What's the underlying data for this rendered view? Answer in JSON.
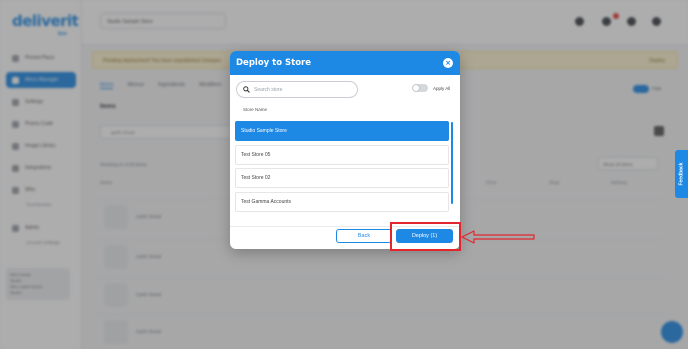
{
  "app": {
    "logo": "deliverit",
    "logo_sub": "bos",
    "store_selector": "Studio Sample Store",
    "sidebar": {
      "items": [
        {
          "label": "Pinned Place"
        },
        {
          "label": "Menu Manager"
        },
        {
          "label": "Settings"
        },
        {
          "label": "Promo Code"
        },
        {
          "label": "Image Library"
        },
        {
          "label": "Integrations"
        },
        {
          "label": "Who"
        },
        {
          "label": "Admin"
        }
      ],
      "sub_items": [
        "Touchscreen",
        "Account Settings"
      ],
      "user": {
        "line1": "Who Invoke",
        "line2": "Studio",
        "line3": "Who Latest Versio",
        "line4": "Studio"
      }
    },
    "banner": {
      "text": "Pending deployment! You have unpublished changes.",
      "action": "Deploy"
    },
    "tabs": [
      "Items",
      "Menus",
      "Ingredients",
      "Modifiers"
    ],
    "toggle_label": "Hide",
    "items_label": "Items",
    "search_placeholder": "garlic bread",
    "showing": "Showing 11 of 28 items",
    "per_page": "Show 20 items",
    "columns": [
      "Name",
      "Price",
      "Shop",
      "Delivery"
    ],
    "rows": [
      {
        "name": "Garlic Bread"
      },
      {
        "name": "Garlic Bread"
      },
      {
        "name": "Garlic Bread"
      },
      {
        "name": "Garlic Bread"
      }
    ],
    "feedback": "Feedback"
  },
  "modal": {
    "title": "Deploy to Store",
    "search_placeholder": "Search store",
    "apply_all_label": "Apply All",
    "column_header": "Store Name",
    "stores": [
      {
        "name": "Studio Sample Store",
        "selected": true
      },
      {
        "name": "Test Store 05",
        "selected": false
      },
      {
        "name": "Test Store 02",
        "selected": false
      },
      {
        "name": "Test Gamma Accounts",
        "selected": false
      }
    ],
    "back_label": "Back",
    "deploy_label": "Deploy (1)"
  },
  "colors": {
    "accent": "#1e88e5",
    "annotation": "#e3262e"
  }
}
